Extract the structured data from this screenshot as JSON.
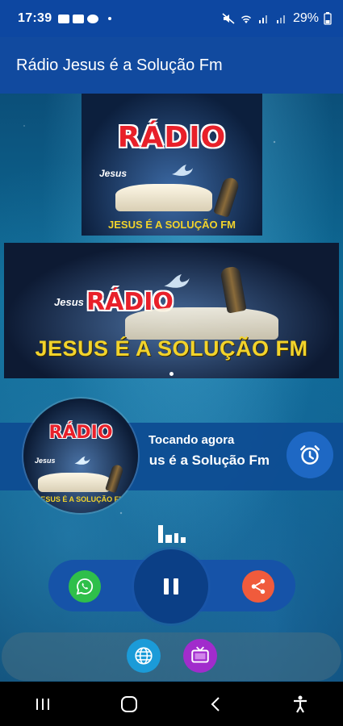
{
  "status_bar": {
    "time": "17:39",
    "battery": "29%"
  },
  "app_bar": {
    "title": "Rádio Jesus é a Solução Fm"
  },
  "logo": {
    "radio_word": "RÁDIO",
    "cross_word": "Jesus",
    "subtitle": "JESUS É A SOLUÇÃO FM"
  },
  "now_playing": {
    "label": "Tocando agora",
    "title": "Rádio Jesus é a Solução Fm"
  },
  "icons": {
    "alarm": "alarm-clock-icon",
    "whatsapp": "whatsapp-icon",
    "share": "share-icon",
    "pause": "pause-icon",
    "web": "globe-icon",
    "tv": "tv-icon",
    "equalizer": "equalizer-icon"
  },
  "colors": {
    "primary": "#114a9f",
    "whatsapp": "#2fbf4a",
    "share": "#f05b3c",
    "web": "#1b9bd8",
    "tv": "#a12ccc"
  }
}
